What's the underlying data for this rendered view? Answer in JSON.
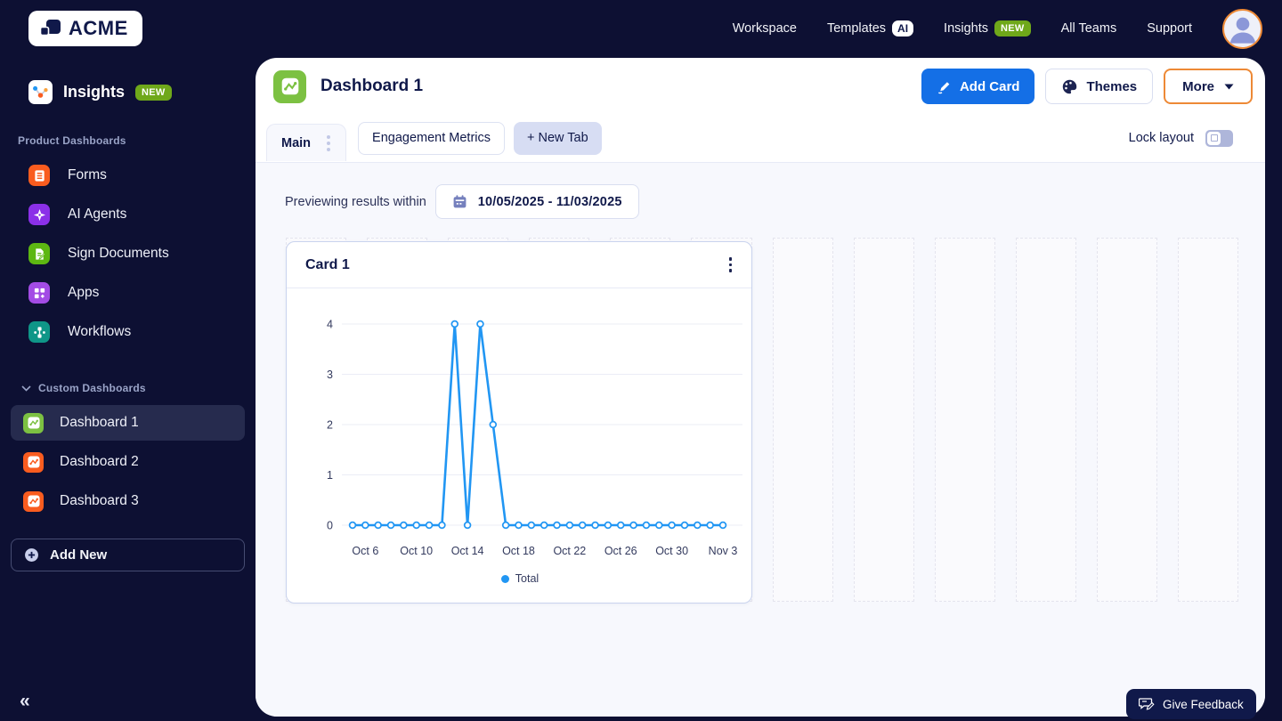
{
  "brand": {
    "logo_text": "ACME"
  },
  "top_nav": {
    "items": [
      {
        "label": "Workspace"
      },
      {
        "label": "Templates",
        "badge": "AI"
      },
      {
        "label": "Insights",
        "badge": "NEW"
      },
      {
        "label": "All Teams"
      },
      {
        "label": "Support"
      }
    ]
  },
  "sidebar": {
    "app_title": "Insights",
    "app_badge": "NEW",
    "section_product": "Product Dashboards",
    "product_items": [
      {
        "label": "Forms",
        "icon": "forms-icon",
        "color": "#f95c1f"
      },
      {
        "label": "AI Agents",
        "icon": "ai-agents-icon",
        "color": "#8b30e8"
      },
      {
        "label": "Sign Documents",
        "icon": "sign-documents-icon",
        "color": "#5db712"
      },
      {
        "label": "Apps",
        "icon": "apps-icon",
        "color": "#a34ce5"
      },
      {
        "label": "Workflows",
        "icon": "workflows-icon",
        "color": "#0f9688"
      }
    ],
    "section_custom": "Custom Dashboards",
    "custom_items": [
      {
        "label": "Dashboard 1",
        "color": "#7cc142"
      },
      {
        "label": "Dashboard 2",
        "color": "#f95c1f"
      },
      {
        "label": "Dashboard 3",
        "color": "#f95c1f"
      }
    ],
    "add_new_label": "Add New",
    "collapse_glyph": "«"
  },
  "header": {
    "title": "Dashboard 1",
    "title_icon_color": "#7cc142",
    "add_card_label": "Add Card",
    "themes_label": "Themes",
    "more_label": "More"
  },
  "tabs": {
    "active_label": "Main",
    "second_label": "Engagement Metrics",
    "new_tab_label": "+ New Tab",
    "lock_layout_label": "Lock layout"
  },
  "filter_bar": {
    "label": "Previewing results within",
    "date_range": "10/05/2025 - 11/03/2025"
  },
  "card": {
    "title": "Card 1"
  },
  "feedback": {
    "label": "Give Feedback"
  },
  "colors": {
    "navy": "#0d1033",
    "primary_blue": "#146fe6",
    "accent_orange": "#ed8936",
    "badge_green": "#6fa81a",
    "chart_blue": "#2196f3",
    "content_bg": "#f7f8fd"
  },
  "chart_data": {
    "type": "line",
    "title": "Card 1",
    "x": [
      "Oct 5",
      "Oct 6",
      "Oct 7",
      "Oct 8",
      "Oct 9",
      "Oct 10",
      "Oct 11",
      "Oct 12",
      "Oct 13",
      "Oct 14",
      "Oct 15",
      "Oct 16",
      "Oct 17",
      "Oct 18",
      "Oct 19",
      "Oct 20",
      "Oct 21",
      "Oct 22",
      "Oct 23",
      "Oct 24",
      "Oct 25",
      "Oct 26",
      "Oct 27",
      "Oct 28",
      "Oct 29",
      "Oct 30",
      "Oct 31",
      "Nov 1",
      "Nov 2",
      "Nov 3"
    ],
    "series": [
      {
        "name": "Total",
        "color": "#2196f3",
        "values": [
          0,
          0,
          0,
          0,
          0,
          0,
          0,
          0,
          4,
          0,
          4,
          2,
          0,
          0,
          0,
          0,
          0,
          0,
          0,
          0,
          0,
          0,
          0,
          0,
          0,
          0,
          0,
          0,
          0,
          0
        ]
      }
    ],
    "x_tick_labels": [
      "Oct 6",
      "Oct 10",
      "Oct 14",
      "Oct 18",
      "Oct 22",
      "Oct 26",
      "Oct 30",
      "Nov 3"
    ],
    "x_tick_indices": [
      1,
      5,
      9,
      13,
      17,
      21,
      25,
      29
    ],
    "ylim": [
      0,
      4
    ],
    "y_ticks": [
      0,
      1,
      2,
      3,
      4
    ],
    "xlabel": "",
    "ylabel": "",
    "grid": true,
    "legend_position": "bottom"
  }
}
